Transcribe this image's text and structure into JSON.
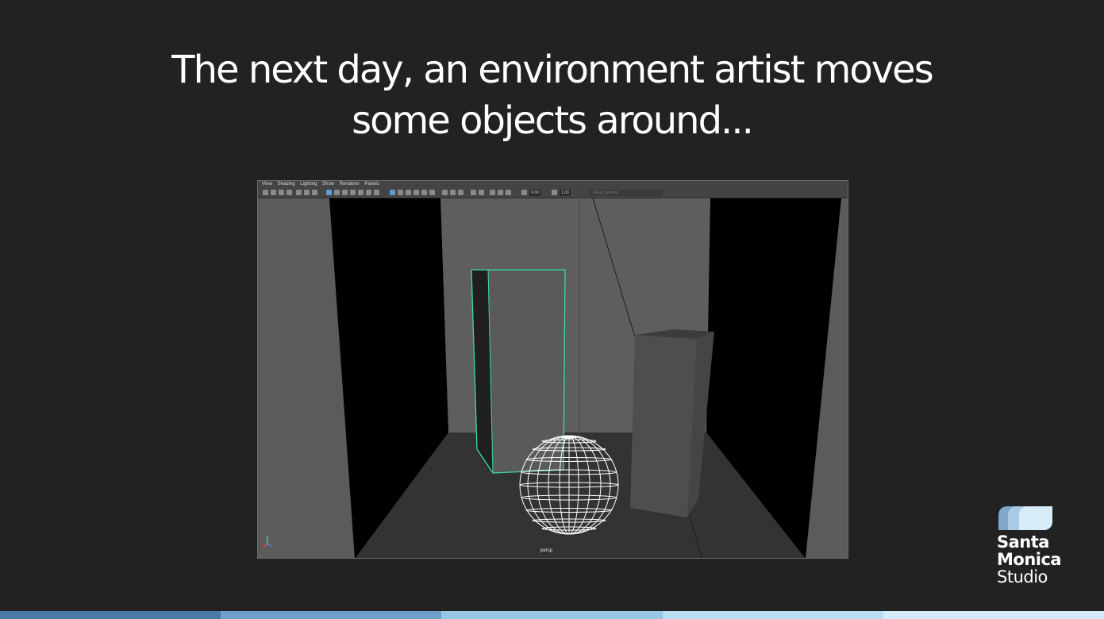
{
  "slide": {
    "title_line1": "The next day, an environment artist moves",
    "title_line2": "some objects around..."
  },
  "viewport": {
    "menu": [
      "View",
      "Shading",
      "Lighting",
      "Show",
      "Renderer",
      "Panels"
    ],
    "field1": "0.00",
    "field2": "1.00",
    "dropdown": "sRGB gamma",
    "camera_label": "persp"
  },
  "logo": {
    "line1": "Santa",
    "line2": "Monica",
    "line3": "Studio"
  },
  "colors": {
    "background": "#222222",
    "bottom_bar": [
      "#4a7aa6",
      "#6fa0cc",
      "#98c6e6",
      "#b9ddf2",
      "#d4ecf8"
    ],
    "selection_highlight": "#3fd6a0"
  }
}
